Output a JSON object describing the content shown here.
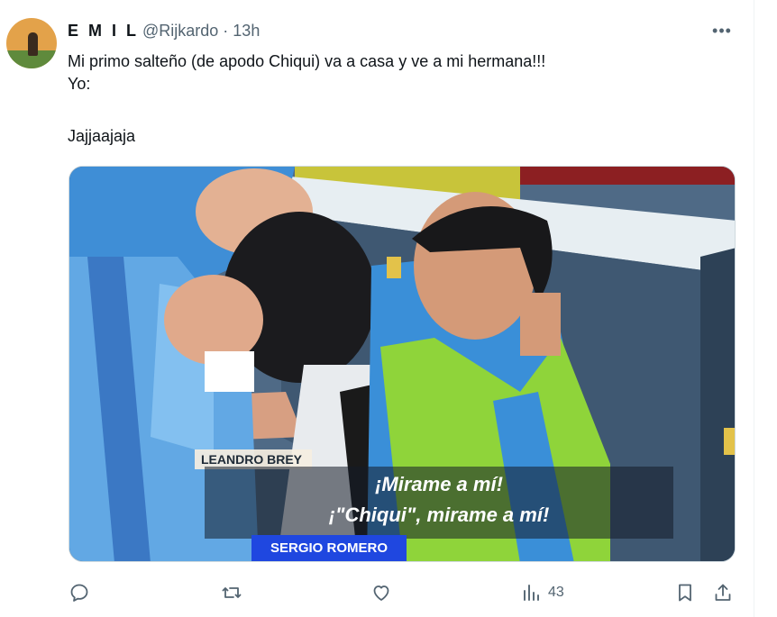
{
  "tweet": {
    "author_name": "E M I L",
    "author_handle": "@Rijkardo",
    "separator": "·",
    "time": "13h",
    "more_glyph": "•••",
    "lines": [
      "Mi primo salteño (de apodo Chiqui) va a casa y ve a mi hermana!!!",
      "Yo:",
      "Jajjaajaja"
    ]
  },
  "media": {
    "name_tag_top": "LEANDRO BREY",
    "subtitle_line1": "¡Mirame a mí!",
    "subtitle_line2": "¡\"Chiqui\", mirame a mí!",
    "name_tag_bottom": "SERGIO ROMERO"
  },
  "actions": {
    "reply_icon": "reply-icon",
    "retweet_icon": "retweet-icon",
    "like_icon": "heart-icon",
    "views_icon": "views-icon",
    "views_count": "43",
    "bookmark_icon": "bookmark-icon",
    "share_icon": "share-icon"
  },
  "colors": {
    "text": "#0f1419",
    "secondary": "#536471",
    "jersey_blue": "#5aa0e0",
    "bib_green": "#8fd43a",
    "tag_blue": "#1f47e0"
  }
}
